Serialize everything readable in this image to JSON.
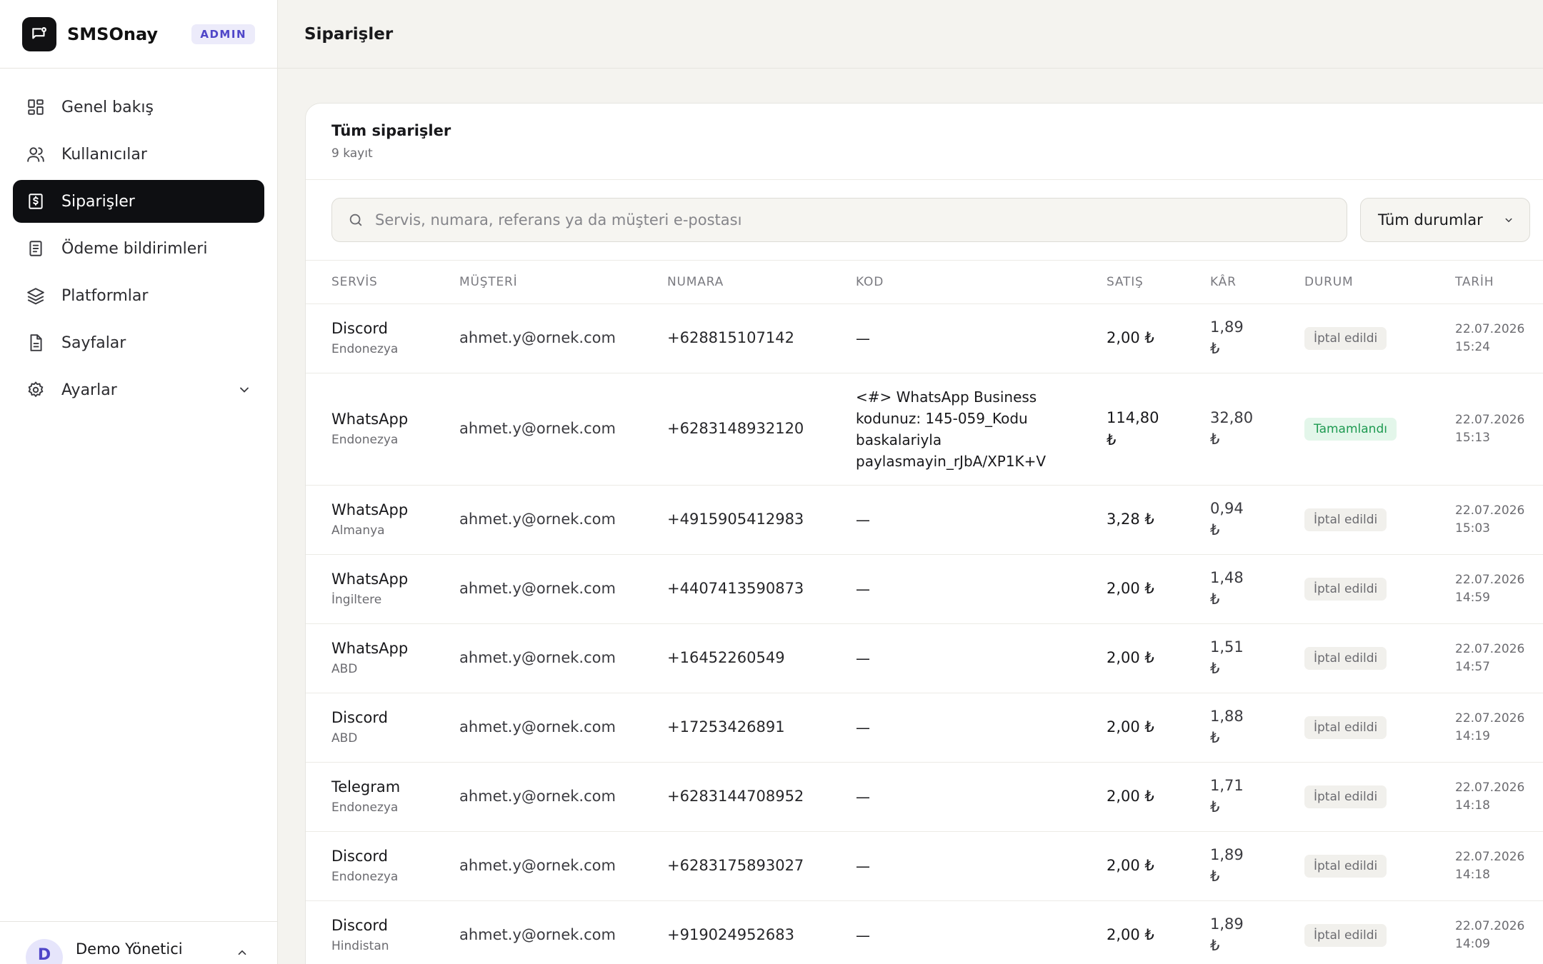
{
  "brand": {
    "name": "SMSOnay",
    "badge": "ADMIN"
  },
  "sidebar": {
    "items": [
      {
        "label": "Genel bakış",
        "icon": "dashboard-icon"
      },
      {
        "label": "Kullanıcılar",
        "icon": "users-icon"
      },
      {
        "label": "Siparişler",
        "icon": "orders-icon",
        "active": true
      },
      {
        "label": "Ödeme bildirimleri",
        "icon": "receipt-icon"
      },
      {
        "label": "Platformlar",
        "icon": "layers-icon"
      },
      {
        "label": "Sayfalar",
        "icon": "file-icon"
      },
      {
        "label": "Ayarlar",
        "icon": "gear-icon"
      }
    ],
    "user": {
      "initial": "D",
      "name": "Demo Yönetici"
    }
  },
  "header": {
    "title": "Siparişler"
  },
  "card": {
    "title": "Tüm siparişler",
    "subtitle": "9 kayıt",
    "search_placeholder": "Servis, numara, referans ya da müşteri e-postası",
    "status_filter": "Tüm durumlar"
  },
  "table": {
    "columns": [
      "SERVİS",
      "MÜŞTERİ",
      "NUMARA",
      "KOD",
      "SATIŞ",
      "KÂR",
      "DURUM",
      "TARİH"
    ],
    "rows": [
      {
        "service": "Discord",
        "country": "Endonezya",
        "customer": "ahmet.y@ornek.com",
        "number": "+628815107142",
        "code": "—",
        "sale": "2,00 ₺",
        "profit": "1,89 ₺",
        "status": "İptal edildi",
        "date": "22.07.2026",
        "time": "15:24"
      },
      {
        "service": "WhatsApp",
        "country": "Endonezya",
        "customer": "ahmet.y@ornek.com",
        "number": "+6283148932120",
        "code": "<#> WhatsApp Business kodunuz: 145-059_Kodu baskalariyla paylasmayin_rJbA/XP1K+V",
        "sale": "114,80 ₺",
        "profit": "32,80 ₺",
        "status": "Tamamlandı",
        "date": "22.07.2026",
        "time": "15:13"
      },
      {
        "service": "WhatsApp",
        "country": "Almanya",
        "customer": "ahmet.y@ornek.com",
        "number": "+4915905412983",
        "code": "—",
        "sale": "3,28 ₺",
        "profit": "0,94 ₺",
        "status": "İptal edildi",
        "date": "22.07.2026",
        "time": "15:03"
      },
      {
        "service": "WhatsApp",
        "country": "İngiltere",
        "customer": "ahmet.y@ornek.com",
        "number": "+4407413590873",
        "code": "—",
        "sale": "2,00 ₺",
        "profit": "1,48 ₺",
        "status": "İptal edildi",
        "date": "22.07.2026",
        "time": "14:59"
      },
      {
        "service": "WhatsApp",
        "country": "ABD",
        "customer": "ahmet.y@ornek.com",
        "number": "+16452260549",
        "code": "—",
        "sale": "2,00 ₺",
        "profit": "1,51 ₺",
        "status": "İptal edildi",
        "date": "22.07.2026",
        "time": "14:57"
      },
      {
        "service": "Discord",
        "country": "ABD",
        "customer": "ahmet.y@ornek.com",
        "number": "+17253426891",
        "code": "—",
        "sale": "2,00 ₺",
        "profit": "1,88 ₺",
        "status": "İptal edildi",
        "date": "22.07.2026",
        "time": "14:19"
      },
      {
        "service": "Telegram",
        "country": "Endonezya",
        "customer": "ahmet.y@ornek.com",
        "number": "+6283144708952",
        "code": "—",
        "sale": "2,00 ₺",
        "profit": "1,71 ₺",
        "status": "İptal edildi",
        "date": "22.07.2026",
        "time": "14:18"
      },
      {
        "service": "Discord",
        "country": "Endonezya",
        "customer": "ahmet.y@ornek.com",
        "number": "+6283175893027",
        "code": "—",
        "sale": "2,00 ₺",
        "profit": "1,89 ₺",
        "status": "İptal edildi",
        "date": "22.07.2026",
        "time": "14:18"
      },
      {
        "service": "Discord",
        "country": "Hindistan",
        "customer": "ahmet.y@ornek.com",
        "number": "+919024952683",
        "code": "—",
        "sale": "2,00 ₺",
        "profit": "1,89 ₺",
        "status": "İptal edildi",
        "date": "22.07.2026",
        "time": "14:09"
      }
    ]
  },
  "colors": {
    "active_nav": "#0e0f12",
    "accent": "#4f46c8",
    "success": "#1e9a51"
  }
}
